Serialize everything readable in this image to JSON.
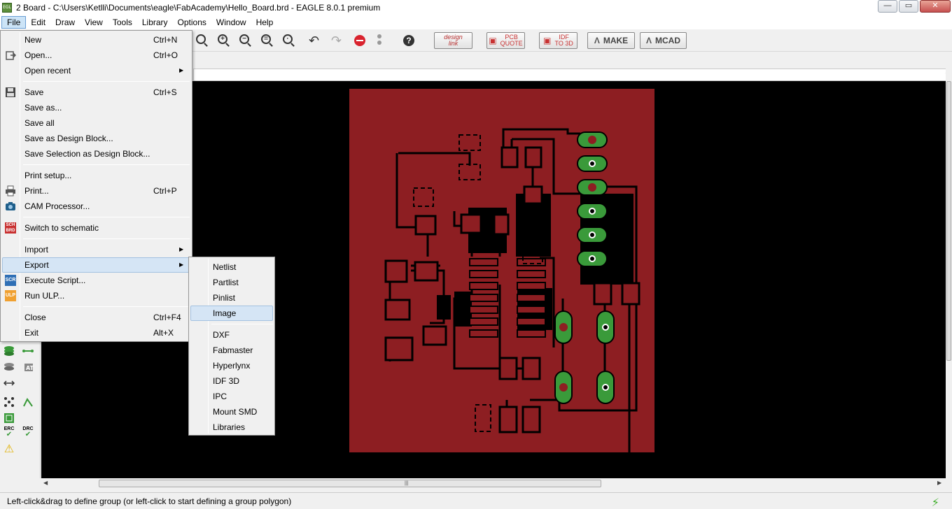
{
  "window": {
    "title": "2 Board - C:\\Users\\Ketlli\\Documents\\eagle\\FabAcademy\\Hello_Board.brd - EAGLE 8.0.1 premium",
    "app_icon": "eagle-icon",
    "buttons": {
      "minimize": "—",
      "maximize": "▭",
      "close": "✕"
    }
  },
  "menubar": {
    "items": [
      {
        "label": "File"
      },
      {
        "label": "Edit"
      },
      {
        "label": "Draw"
      },
      {
        "label": "View"
      },
      {
        "label": "Tools"
      },
      {
        "label": "Library"
      },
      {
        "label": "Options"
      },
      {
        "label": "Window"
      },
      {
        "label": "Help"
      }
    ]
  },
  "toolbar": {
    "zoom_icons": [
      "zoom-fit-icon",
      "zoom-in-icon",
      "zoom-out-icon",
      "zoom-select-icon",
      "zoom-dropdown-icon"
    ],
    "undo": "↶",
    "redo": "↷",
    "help": "?",
    "design_link": {
      "line1": "design",
      "line2": "link"
    },
    "pcb_quote": {
      "line1": "PCB",
      "line2": "QUOTE"
    },
    "idf_3d": {
      "line1": "IDF",
      "line2": "TO 3D"
    },
    "make_label": "MAKE",
    "mcad_label": "MCAD"
  },
  "palette": {
    "icons": [
      "layers-icon",
      "route-icon",
      "layers-alt-icon",
      "autorouter-icon",
      "measure-icon",
      "airwire-icon",
      "route-manual-icon",
      "ratsnest-icon",
      "erc-icon",
      "drc-icon",
      "warning-icon"
    ],
    "labels": {
      "at": "AT",
      "erc": "ERC",
      "drc": "DRC"
    }
  },
  "file_menu": {
    "items": [
      {
        "label": "New",
        "shortcut": "Ctrl+N"
      },
      {
        "label": "Open...",
        "shortcut": "Ctrl+O"
      },
      {
        "label": "Open recent",
        "shortcut": "",
        "submenu": true
      },
      {
        "label": "Save",
        "shortcut": "Ctrl+S"
      },
      {
        "label": "Save as...",
        "shortcut": ""
      },
      {
        "label": "Save all",
        "shortcut": ""
      },
      {
        "label": "Save as Design Block...",
        "shortcut": ""
      },
      {
        "label": "Save Selection as Design Block...",
        "shortcut": ""
      },
      {
        "label": "Print setup...",
        "shortcut": ""
      },
      {
        "label": "Print...",
        "shortcut": "Ctrl+P"
      },
      {
        "label": "CAM Processor...",
        "shortcut": ""
      },
      {
        "label": "Switch to schematic",
        "shortcut": ""
      },
      {
        "label": "Import",
        "shortcut": "",
        "submenu": true
      },
      {
        "label": "Export",
        "shortcut": "",
        "submenu": true,
        "highlighted": true
      },
      {
        "label": "Execute Script...",
        "shortcut": ""
      },
      {
        "label": "Run ULP...",
        "shortcut": ""
      },
      {
        "label": "Close",
        "shortcut": "Ctrl+F4"
      },
      {
        "label": "Exit",
        "shortcut": "Alt+X"
      }
    ],
    "icon_text": {
      "sch_top": "SCH",
      "sch_bottom": "BRD",
      "scr": "SCR",
      "ulp": "ULP"
    }
  },
  "export_menu": {
    "items": [
      {
        "label": "Netlist"
      },
      {
        "label": "Partlist"
      },
      {
        "label": "Pinlist"
      },
      {
        "label": "Image",
        "highlighted": true
      },
      {
        "label": "DXF"
      },
      {
        "label": "Fabmaster"
      },
      {
        "label": "Hyperlynx"
      },
      {
        "label": "IDF 3D"
      },
      {
        "label": "IPC"
      },
      {
        "label": "Mount SMD"
      },
      {
        "label": "Libraries"
      }
    ]
  },
  "scrollbar": {
    "grip": "|||",
    "up": "▲",
    "down": "▼",
    "left": "◀",
    "right": "▶",
    "more": "▼"
  },
  "status": {
    "text": "Left-click&drag to define group (or left-click to start defining a group polygon)",
    "bolt": "⚡"
  },
  "colors": {
    "board": "#8d1e22",
    "canvas": "#000000",
    "trace_outline": "#000000",
    "pad_tht": "#3a9a3a",
    "menu_highlight": "#d5e5f5"
  }
}
